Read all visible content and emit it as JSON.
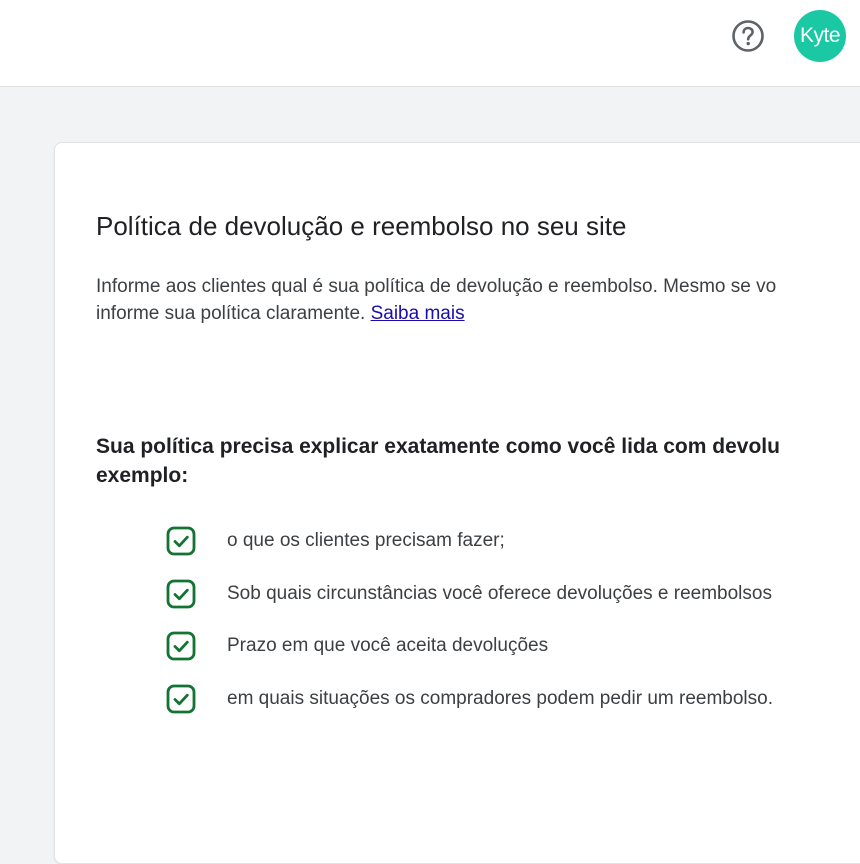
{
  "header": {
    "help_icon": "help-circle-icon",
    "avatar_label": "Kyte",
    "avatar_color": "#1ac8a4"
  },
  "card": {
    "title": "Política de devolução e reembolso no seu site",
    "description_line1": "Informe aos clientes qual é sua política de devolução e reembolso. Mesmo se vo",
    "description_line2": "informe sua política claramente. ",
    "learn_more_link": "Saiba mais",
    "section_heading_line1": "Sua política precisa explicar exatamente como você lida com devolu",
    "section_heading_line2": "exemplo:",
    "check_icon": "checkbox-checked-icon",
    "check_color": "#137333",
    "checklist": [
      {
        "text": "o que os clientes precisam fazer;"
      },
      {
        "text": "Sob quais circunstâncias você oferece devoluções e reembolsos"
      },
      {
        "text": "Prazo em que você aceita devoluções"
      },
      {
        "text": "em quais situações os compradores podem pedir um reembolso."
      }
    ]
  }
}
